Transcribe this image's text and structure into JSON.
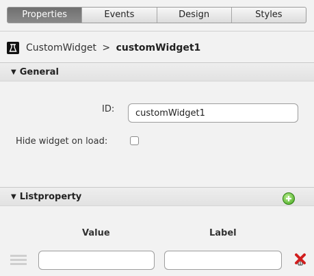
{
  "tabs": [
    {
      "label": "Properties",
      "active": true
    },
    {
      "label": "Events"
    },
    {
      "label": "Design"
    },
    {
      "label": "Styles"
    }
  ],
  "breadcrumb": {
    "type": "CustomWidget",
    "separator": ">",
    "name": "customWidget1"
  },
  "general": {
    "title": "General",
    "id_label": "ID:",
    "id_value": "customWidget1",
    "hide_label": "Hide widget on load:",
    "hide_checked": false
  },
  "listproperty": {
    "title": "Listproperty",
    "columns": {
      "value": "Value",
      "label": "Label"
    },
    "rows": [
      {
        "value": "",
        "label": ""
      }
    ]
  },
  "colors": {
    "add_green": "#3fa31a",
    "delete_red": "#d11f1f"
  }
}
